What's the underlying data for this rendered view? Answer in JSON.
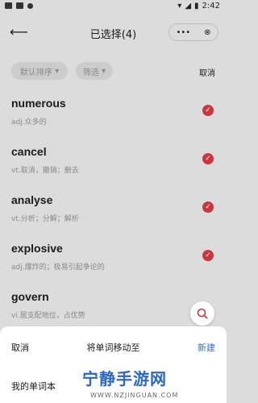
{
  "status_bar": {
    "time": "2:42"
  },
  "header": {
    "back_icon": "arrow-left-icon",
    "title": "已选择(4)",
    "more_icon": "more-dots-icon",
    "close_icon": "close-circle-icon"
  },
  "filters": {
    "sort_label": "默认排序",
    "filter_label": "筛选",
    "cancel_label": "取消"
  },
  "words": [
    {
      "word": "numerous",
      "definition": "adj.众多的",
      "selected": true
    },
    {
      "word": "cancel",
      "definition": "vt.取消，撤销；删去",
      "selected": true
    },
    {
      "word": "analyse",
      "definition": "vt.分析；分解；解析",
      "selected": true
    },
    {
      "word": "explosive",
      "definition": "adj.爆炸的；极易引起争论的",
      "selected": true
    },
    {
      "word": "govern",
      "definition": "vi.居支配地位，占优势",
      "selected": false
    }
  ],
  "sheet": {
    "cancel_label": "取消",
    "title": "将单词移动至",
    "new_label": "新建",
    "wordbook_label": "我的单词本"
  },
  "watermark": {
    "brand": "宁静手游网",
    "url": "WWW.NZJINGUAN.COM"
  },
  "colors": {
    "check": "#c9363d",
    "link": "#2a6fe0"
  }
}
